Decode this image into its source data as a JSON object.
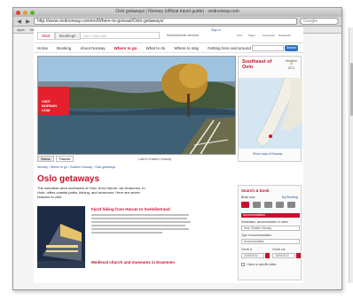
{
  "window": {
    "title": "Oslo getaways | Norway (official travel guide) - visitnorway.com"
  },
  "browser": {
    "url": "http://www.visitnorway.com/en/Where-to-go/east/Oslo-getaways/",
    "search_placeholder": "Google",
    "bookmarks": [
      "Apple",
      "Yahoo!",
      "Google Maps",
      "YouTube",
      "Wikipedia",
      "News (226)",
      "Popular",
      "Bookmarks",
      "Translate",
      "Facebook",
      "Hotmail",
      "Apple"
    ]
  },
  "site": {
    "tab_start": "Start",
    "tab_bookings": "Bookings",
    "search_placeholder": "Søk i hele side",
    "language": "International version",
    "login": "Sign in",
    "header_icons": [
      "Print",
      "Share",
      "Favourites",
      "Newsletter"
    ],
    "nav": [
      "Home",
      "Booking",
      "About Norway",
      "Where to go",
      "What to do",
      "Where to stay",
      "Getting here and around"
    ],
    "nav_active_index": 3,
    "search_button": "Search"
  },
  "hero": {
    "logo_line1": "VISIT",
    "logo_line2": "NORWAY",
    "logo_line3": "COM",
    "tabs": [
      "Videos",
      "Pictures"
    ],
    "caption": "Lake in Eastern Norway"
  },
  "map": {
    "title_line1": "Southeast of",
    "title_line2": "Oslo",
    "weather_label": "Weather",
    "temperature": "16°C",
    "link": "Show map of Norway"
  },
  "breadcrumb": "Norway › Where to go › Eastern Norway › Oslo getaways",
  "article": {
    "title": "Oslo getaways",
    "intro": "The suburban area southwest of Oslo, from Hurum, via Drammen, to Hole, offers coastal paths, fishing, and museums. Here are seven reasons to visit.",
    "item1_title": "Fjord hiking from Hurum to Svelvikstrand",
    "item2_title": "Medieval church and museums in Drammen"
  },
  "booking": {
    "title": "Search & book",
    "subtitle": "Book now",
    "my_booking": "My Booking",
    "bar": "Accommodation",
    "label_destination": "Destination, accommodation or name",
    "destination_value": "Hole, Eastern Norway",
    "label_type": "Type of accommodation",
    "type_value": "Accommodation",
    "label_checkin": "Check in",
    "checkin_value": "21/06/2012",
    "label_checkout": "Check out",
    "checkout_value": "22/06/2012",
    "flexible": "I have no specific dates"
  },
  "colors": {
    "brand_red": "#c8102e",
    "link_blue": "#2a5a9a"
  }
}
